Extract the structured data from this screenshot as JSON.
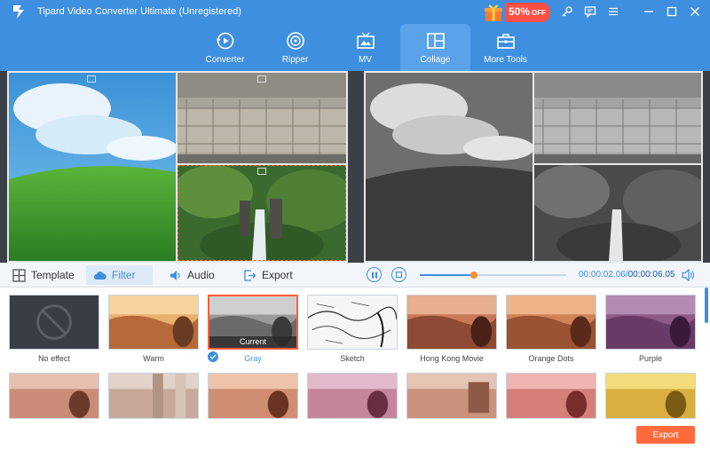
{
  "app": {
    "title": "Tipard Video Converter Ultimate (Unregistered)",
    "promo": {
      "percent": "50%",
      "suffix": "OFF"
    },
    "accent": "#3f8fe0",
    "highlight": "#ff5f3b"
  },
  "window_controls": [
    "key-icon",
    "chat-icon",
    "menu-icon",
    "minimize-icon",
    "maximize-icon",
    "close-icon"
  ],
  "nav": {
    "items": [
      {
        "label": "Converter",
        "icon": "converter-icon"
      },
      {
        "label": "Ripper",
        "icon": "disc-icon"
      },
      {
        "label": "MV",
        "icon": "tv-icon"
      },
      {
        "label": "Collage",
        "icon": "collage-icon"
      },
      {
        "label": "More Tools",
        "icon": "toolbox-icon"
      }
    ],
    "active": "Collage"
  },
  "tabs": {
    "template": "Template",
    "filter": "Filter",
    "audio": "Audio",
    "export": "Export",
    "active": "Filter"
  },
  "player": {
    "current_time": "00:00:02.06",
    "separator": "/",
    "total_time": "00:00:06.05",
    "progress": 0.37
  },
  "filters": {
    "current_label": "Current",
    "selected": "Gray",
    "row1": [
      "No effect",
      "Warm",
      "Gray",
      "Sketch",
      "Hong Kong Movie",
      "Orange Dots",
      "Purple"
    ]
  },
  "export_button": "Export"
}
